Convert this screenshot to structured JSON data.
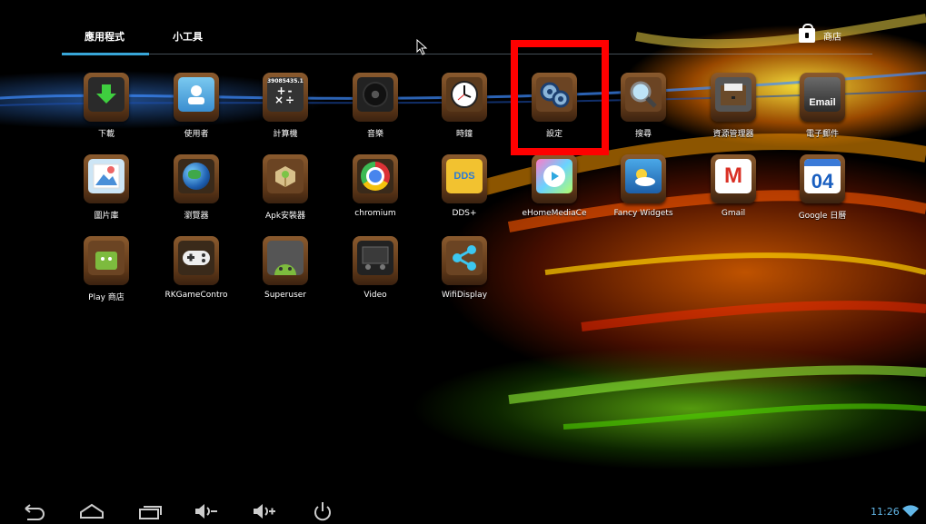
{
  "tabs": {
    "apps": "應用程式",
    "widgets": "小工具"
  },
  "store": {
    "label": "商店"
  },
  "apps": [
    {
      "label": "下載",
      "icon": "download-icon"
    },
    {
      "label": "使用者",
      "icon": "user-icon"
    },
    {
      "label": "計算機",
      "icon": "calculator-icon",
      "display": "39085435.12"
    },
    {
      "label": "音樂",
      "icon": "music-icon"
    },
    {
      "label": "時鐘",
      "icon": "clock-icon"
    },
    {
      "label": "設定",
      "icon": "settings-icon"
    },
    {
      "label": "搜尋",
      "icon": "search-icon"
    },
    {
      "label": "資源管理器",
      "icon": "file-manager-icon"
    },
    {
      "label": "電子郵件",
      "icon": "email-icon",
      "text": "Email"
    },
    {
      "label": "圖片庫",
      "icon": "gallery-icon"
    },
    {
      "label": "瀏覽器",
      "icon": "browser-icon"
    },
    {
      "label": "Apk安裝器",
      "icon": "apk-installer-icon"
    },
    {
      "label": "chromium",
      "icon": "chromium-icon"
    },
    {
      "label": "DDS+",
      "icon": "dds-icon",
      "text": "DDS"
    },
    {
      "label": "eHomeMediaCe",
      "icon": "ehome-media-icon"
    },
    {
      "label": "Fancy Widgets",
      "icon": "fancy-widgets-icon"
    },
    {
      "label": "Gmail",
      "icon": "gmail-icon",
      "text": "M"
    },
    {
      "label": "Google 日曆",
      "icon": "calendar-icon",
      "text": "04"
    },
    {
      "label": "Play 商店",
      "icon": "play-store-icon"
    },
    {
      "label": "RKGameContro",
      "icon": "gamepad-icon"
    },
    {
      "label": "Superuser",
      "icon": "superuser-icon"
    },
    {
      "label": "Video",
      "icon": "video-icon"
    },
    {
      "label": "WifiDisplay",
      "icon": "share-icon"
    }
  ],
  "status": {
    "time": "11:26"
  },
  "colors": {
    "accent": "#38a6d8",
    "highlight": "#ff0000",
    "tile": "#6b4423"
  }
}
